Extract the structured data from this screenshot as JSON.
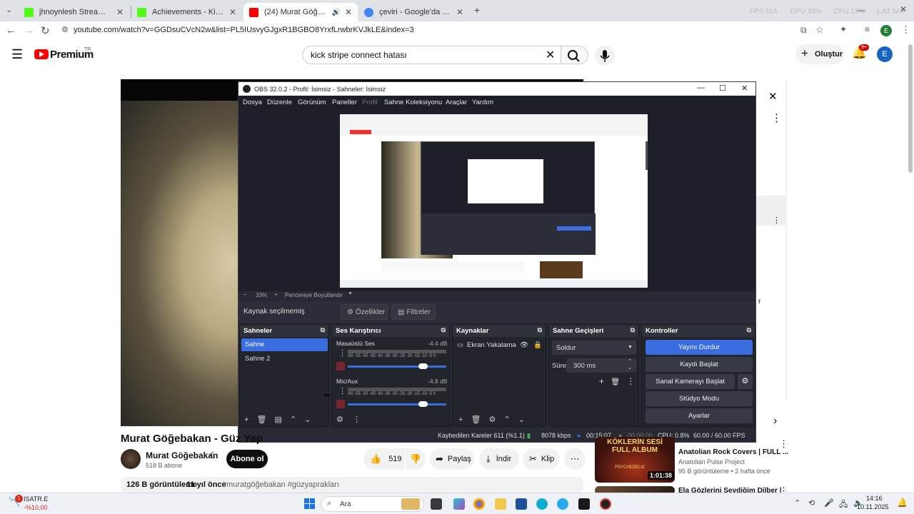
{
  "browser": {
    "tabs": [
      {
        "title": "jhnoynlesh Stream - Watch Live",
        "fav_color": "#53fc18",
        "active": false
      },
      {
        "title": "Achievements - Kick Dashboard",
        "fav_color": "#53fc18",
        "active": false
      },
      {
        "title": "(24) Murat Göğebakan - Gü",
        "fav_color": "#ff0000",
        "active": true
      },
      {
        "title": "çeviri - Google'da Ara",
        "fav_color": "#4285f4",
        "active": false
      }
    ],
    "perf": [
      {
        "label": "FPS",
        "value": "N/A"
      },
      {
        "label": "GPU",
        "value": "36%"
      },
      {
        "label": "CPU",
        "value": "15%"
      },
      {
        "label": "LAT",
        "value": "N/A"
      }
    ],
    "url": "youtube.com/watch?v=GGDsuCVcN2w&list=PL5IUsvyGJgxR1BGBO8YrxfLrwbrKVJkLE&index=3",
    "profile_initial": "E"
  },
  "youtube": {
    "logo_text": "Premium",
    "logo_region": "TR",
    "search_value": "kick stripe connect hatası",
    "create_label": "Oluştur",
    "notif_count": "9+",
    "avatar_initial": "E",
    "video_title": "Murat Göğebakan - Güz Yap",
    "channel_name": "Murat Göğebakan",
    "subscribers": "518 B abone",
    "subscribe_label": "Abone ol",
    "likes": "519",
    "share_label": "Paylaş",
    "download_label": "İndir",
    "clip_label": "Klip",
    "views": "126 B görüntüleme",
    "age": "11 yıl önce",
    "hashtags": "#muratgöğebakan #güzyaprakları",
    "recommendations": [
      {
        "thumb_text": "KÖKLERİN SESİ FULL ALBUM",
        "thumb_sub": "PSYCHEDELIC",
        "duration": "1:01:38",
        "title": "Anatolian Rock Covers | FULL ...",
        "channel": "Anatolian Pulse Project",
        "meta": "95 B görüntüleme • 2 hafta önce"
      },
      {
        "title": "Ela Gözlerini Sevdiğim Dilber |"
      }
    ]
  },
  "obs": {
    "title": "OBS 32.0.2 - Profil: İsimsiz - Sahneler: İsimsiz",
    "menu": [
      "Dosya",
      "Düzenle",
      "Görünüm",
      "Paneller",
      "Profil",
      "Sahne Koleksiyonu",
      "Araçlar",
      "Yardım"
    ],
    "zoom": "33%",
    "fit_label": "Pencereye Boyutlandır",
    "no_source": "Kaynak seçilmemiş",
    "properties_label": "Özellikler",
    "filters_label": "Filtreler",
    "docks": {
      "scenes": "Sahneler",
      "mixer": "Ses Karıştırıcı",
      "sources": "Kaynaklar",
      "transitions": "Sahne Geçişleri",
      "controls": "Kontroller"
    },
    "scenes": [
      "Sahne",
      "Sahne 2"
    ],
    "mixer": [
      {
        "name": "Masaüstü Ses",
        "db": "-4.4 dB",
        "level": 0.8
      },
      {
        "name": "Mic/Aux",
        "db": "-4.8 dB",
        "level": 0.8
      }
    ],
    "meter_ticks": "-60 -55 -50 -45 -40 -35 -30 -25 -20 -15 -10 -5 0",
    "sources": [
      "Ekran Yakalama"
    ],
    "transition": "Soldur",
    "duration_label": "Süre",
    "duration_value": "300 ms",
    "controls": [
      "Yayını Durdur",
      "Kaydı Başlat",
      "Sanal Kamerayı Başlat",
      "Stüdyo Modu",
      "Ayarlar"
    ],
    "status": {
      "dropped": "Kaybedilen Kareler 611 (%1.1)",
      "bitrate": "8078 kbps",
      "live_time": "00:15:07",
      "rec_time": "00:00:00",
      "cpu": "CPU: 0.8%",
      "fps": "60.00 / 60.00 FPS"
    }
  },
  "taskbar": {
    "ticker_name": "ISATR.E",
    "ticker_change": "-%10,00",
    "ticker_badge": "1",
    "search_label": "Ara",
    "time": "14:16",
    "date": "10.11.2025"
  }
}
